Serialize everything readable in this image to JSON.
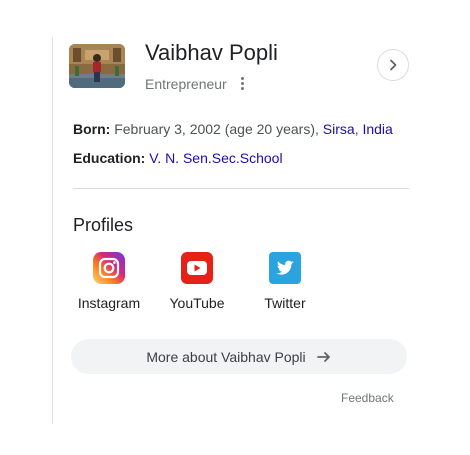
{
  "header": {
    "name": "Vaibhav Popli",
    "subtitle": "Entrepreneur",
    "thumbnail_alt": "Vaibhav Popli photo",
    "menu_icon": "more-vert-icon",
    "expand_icon": "chevron-right-icon"
  },
  "facts": {
    "born": {
      "label": "Born:",
      "text": "February 3, 2002 (age 20 years),",
      "place_city": "Sirsa",
      "separator": ",",
      "place_country": "India"
    },
    "education": {
      "label": "Education:",
      "value": "V. N. Sen.Sec.School"
    }
  },
  "profiles": {
    "title": "Profiles",
    "items": [
      {
        "label": "Instagram",
        "icon": "instagram-icon"
      },
      {
        "label": "YouTube",
        "icon": "youtube-icon"
      },
      {
        "label": "Twitter",
        "icon": "twitter-icon"
      }
    ]
  },
  "more_button": {
    "label": "More about Vaibhav Popli",
    "icon": "arrow-right-icon"
  },
  "feedback": "Feedback",
  "colors": {
    "link": "#1a0dab",
    "instagram": "#c13584",
    "youtube": "#e62117",
    "twitter": "#2aa3de"
  }
}
